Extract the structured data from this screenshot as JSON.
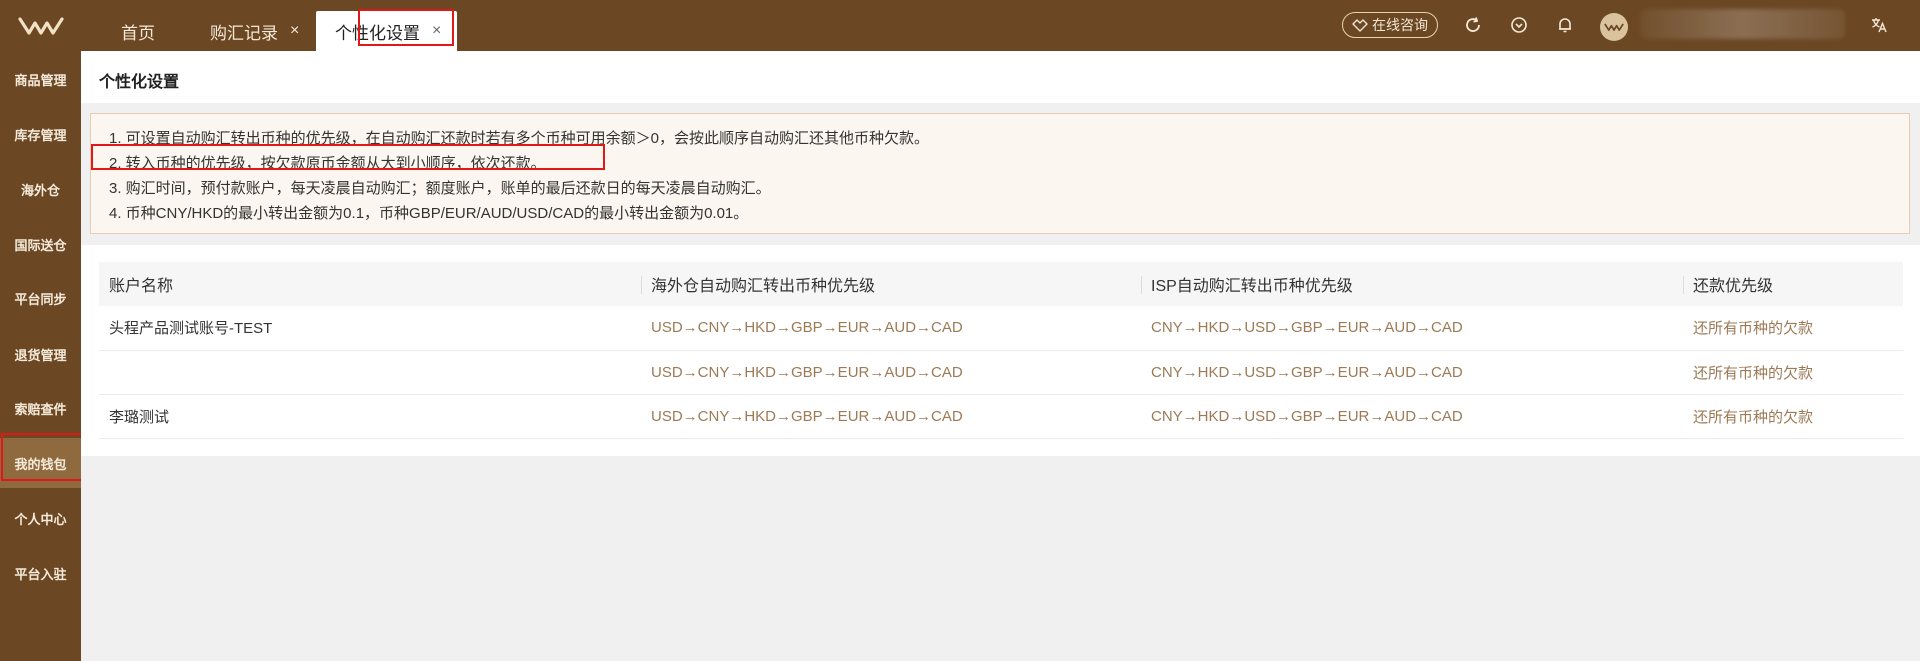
{
  "header": {
    "tabs": [
      {
        "label": "首页",
        "closable": false
      },
      {
        "label": "购汇记录",
        "closable": true
      },
      {
        "label": "个性化设置",
        "closable": true,
        "active": true
      }
    ],
    "close_glyph": "×",
    "consult_label": "在线咨询",
    "icons": [
      "refresh-icon",
      "favorite-icon",
      "bell-icon",
      "translate-icon"
    ]
  },
  "sidebar": {
    "items": [
      {
        "label": "商品管理"
      },
      {
        "label": "库存管理"
      },
      {
        "label": "海外仓"
      },
      {
        "label": "国际送仓"
      },
      {
        "label": "平台同步"
      },
      {
        "label": "退货管理"
      },
      {
        "label": "索赔查件"
      },
      {
        "label": "我的钱包",
        "active": true
      },
      {
        "label": "个人中心"
      },
      {
        "label": "平台入驻"
      }
    ]
  },
  "main": {
    "title": "个性化设置",
    "notices": [
      "1. 可设置自动购汇转出币种的优先级，在自动购汇还款时若有多个币种可用余额＞0，会按此顺序自动购汇还其他币种欠款。",
      "2. 转入币种的优先级，按欠款原币金额从大到小顺序，依次还款。",
      "3. 购汇时间，预付款账户，每天凌晨自动购汇；额度账户，账单的最后还款日的每天凌晨自动购汇。",
      "4. 币种CNY/HKD的最小转出金额为0.1，币种GBP/EUR/AUD/USD/CAD的最小转出金额为0.01。"
    ],
    "table": {
      "headers": [
        "账户名称",
        "海外仓自动购汇转出币种优先级",
        "ISP自动购汇转出币种优先级",
        "还款优先级"
      ],
      "rows": [
        [
          "头程产品测试账号-TEST",
          "USD→CNY→HKD→GBP→EUR→AUD→CAD",
          "CNY→HKD→USD→GBP→EUR→AUD→CAD",
          "还所有币种的欠款"
        ],
        [
          "",
          "USD→CNY→HKD→GBP→EUR→AUD→CAD",
          "CNY→HKD→USD→GBP→EUR→AUD→CAD",
          "还所有币种的欠款"
        ],
        [
          "李璐测试",
          "USD→CNY→HKD→GBP→EUR→AUD→CAD",
          "CNY→HKD→USD→GBP→EUR→AUD→CAD",
          "还所有币种的欠款"
        ]
      ]
    }
  },
  "colors": {
    "brand": "#6b4723",
    "sidebar_active": "#8f6a3f",
    "currency_text": "#9c7a55",
    "highlight": "#e01818"
  }
}
